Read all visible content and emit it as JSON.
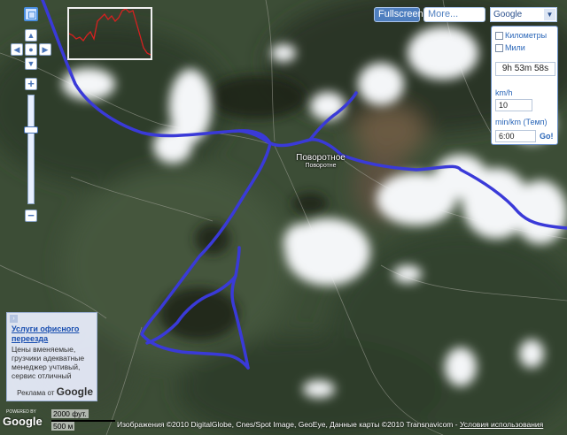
{
  "controls": {
    "pan_up": "▲",
    "pan_left": "◀",
    "pan_center": "●",
    "pan_right": "▶",
    "pan_down": "▼",
    "zoom_in": "+",
    "zoom_out": "−"
  },
  "top_buttons": {
    "fullscreen": "Fullscreen",
    "more": "More...",
    "map_type": "Google"
  },
  "pace_panel": {
    "km_option": "Километры",
    "miles_option": "Мили",
    "total_time": "9h 53m 58s",
    "speed_label": "km/h",
    "speed_value": "10",
    "pace_label": "min/km (Темп)",
    "pace_value": "6:00",
    "go_label": "Go!"
  },
  "map": {
    "town_name": "Поворотное",
    "town_name_alt": "Поворотне",
    "route_color": "#3a3ad8"
  },
  "ad": {
    "title": "Услуги офисного переезда",
    "body": "Цены вменяемые, грузчики адекватные менеджер учтивый, сервис отличный",
    "footer_prefix": "Реклама от",
    "footer_brand": "Google"
  },
  "bottom": {
    "powered_by": "POWERED BY",
    "logo": "Google",
    "scale_top": "2000 фут.",
    "scale_bottom": "500 м",
    "attribution": "Изображения ©2010 DigitalGlobe, Cnes/Spot Image, GeoEye, Данные карты ©2010 Transnavicom - ",
    "terms_link": "Условия использования"
  }
}
